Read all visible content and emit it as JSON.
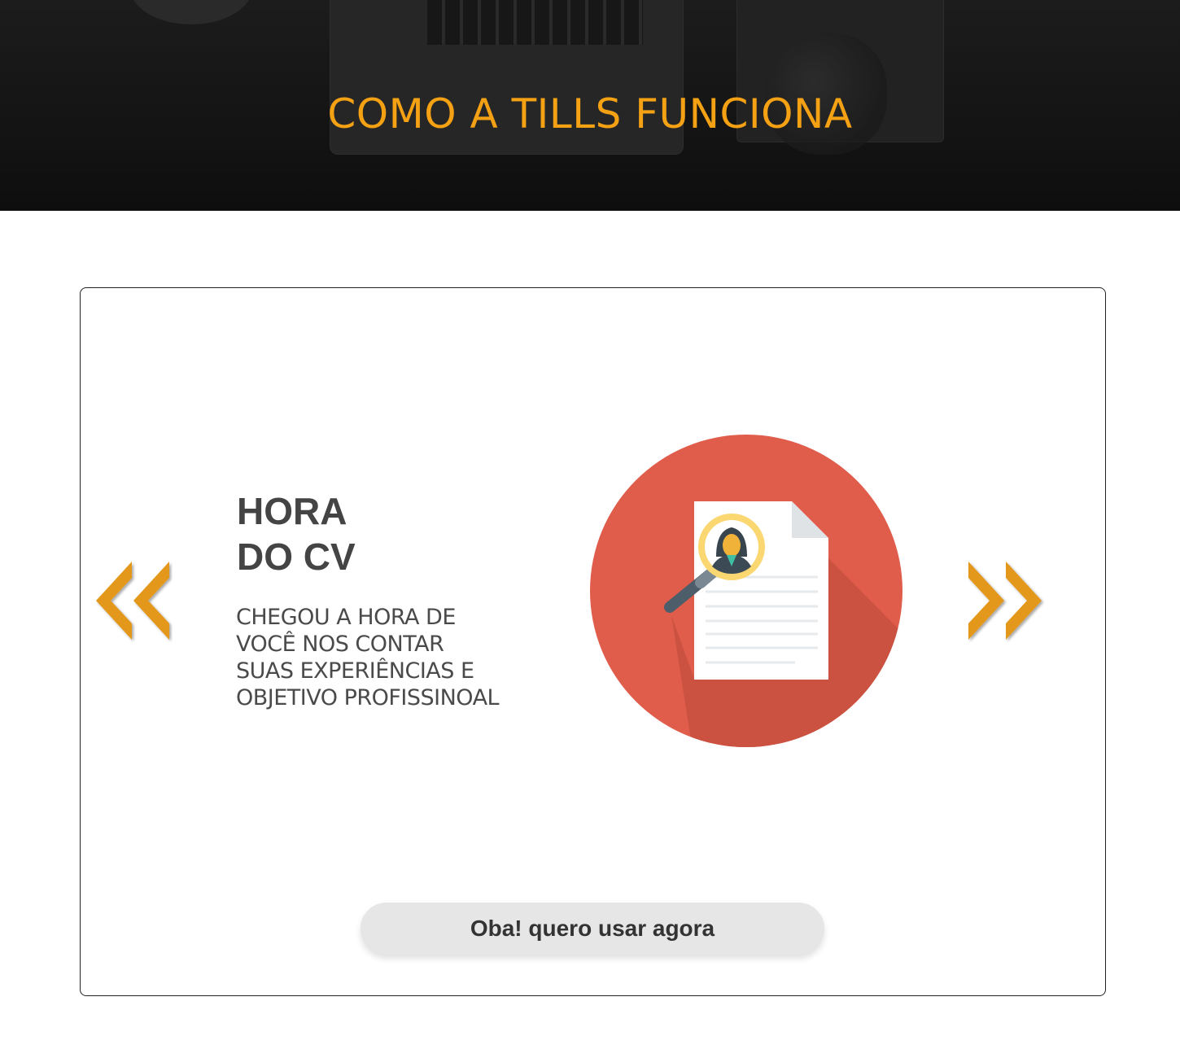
{
  "hero": {
    "title": "COMO A TILLS FUNCIONA"
  },
  "slide": {
    "title_line1": "HORA",
    "title_line2": "DO CV",
    "description_lines": [
      "CHEGOU A HORA DE",
      "VOCÊ NOS CONTAR",
      "SUAS EXPERIÊNCIAS E",
      "OBJETIVO PROFISSINOAL"
    ],
    "illustration_icon": "cv-search-icon"
  },
  "carousel": {
    "prev_icon": "double-chevron-left-icon",
    "next_icon": "double-chevron-right-icon"
  },
  "cta": {
    "label": "Oba! quero usar agora"
  },
  "colors": {
    "accent": "#f5a114",
    "arrow": "#e3981f",
    "circle": "#e05c4b",
    "text_dark": "#444444",
    "button_bg": "#e6e6e6"
  }
}
